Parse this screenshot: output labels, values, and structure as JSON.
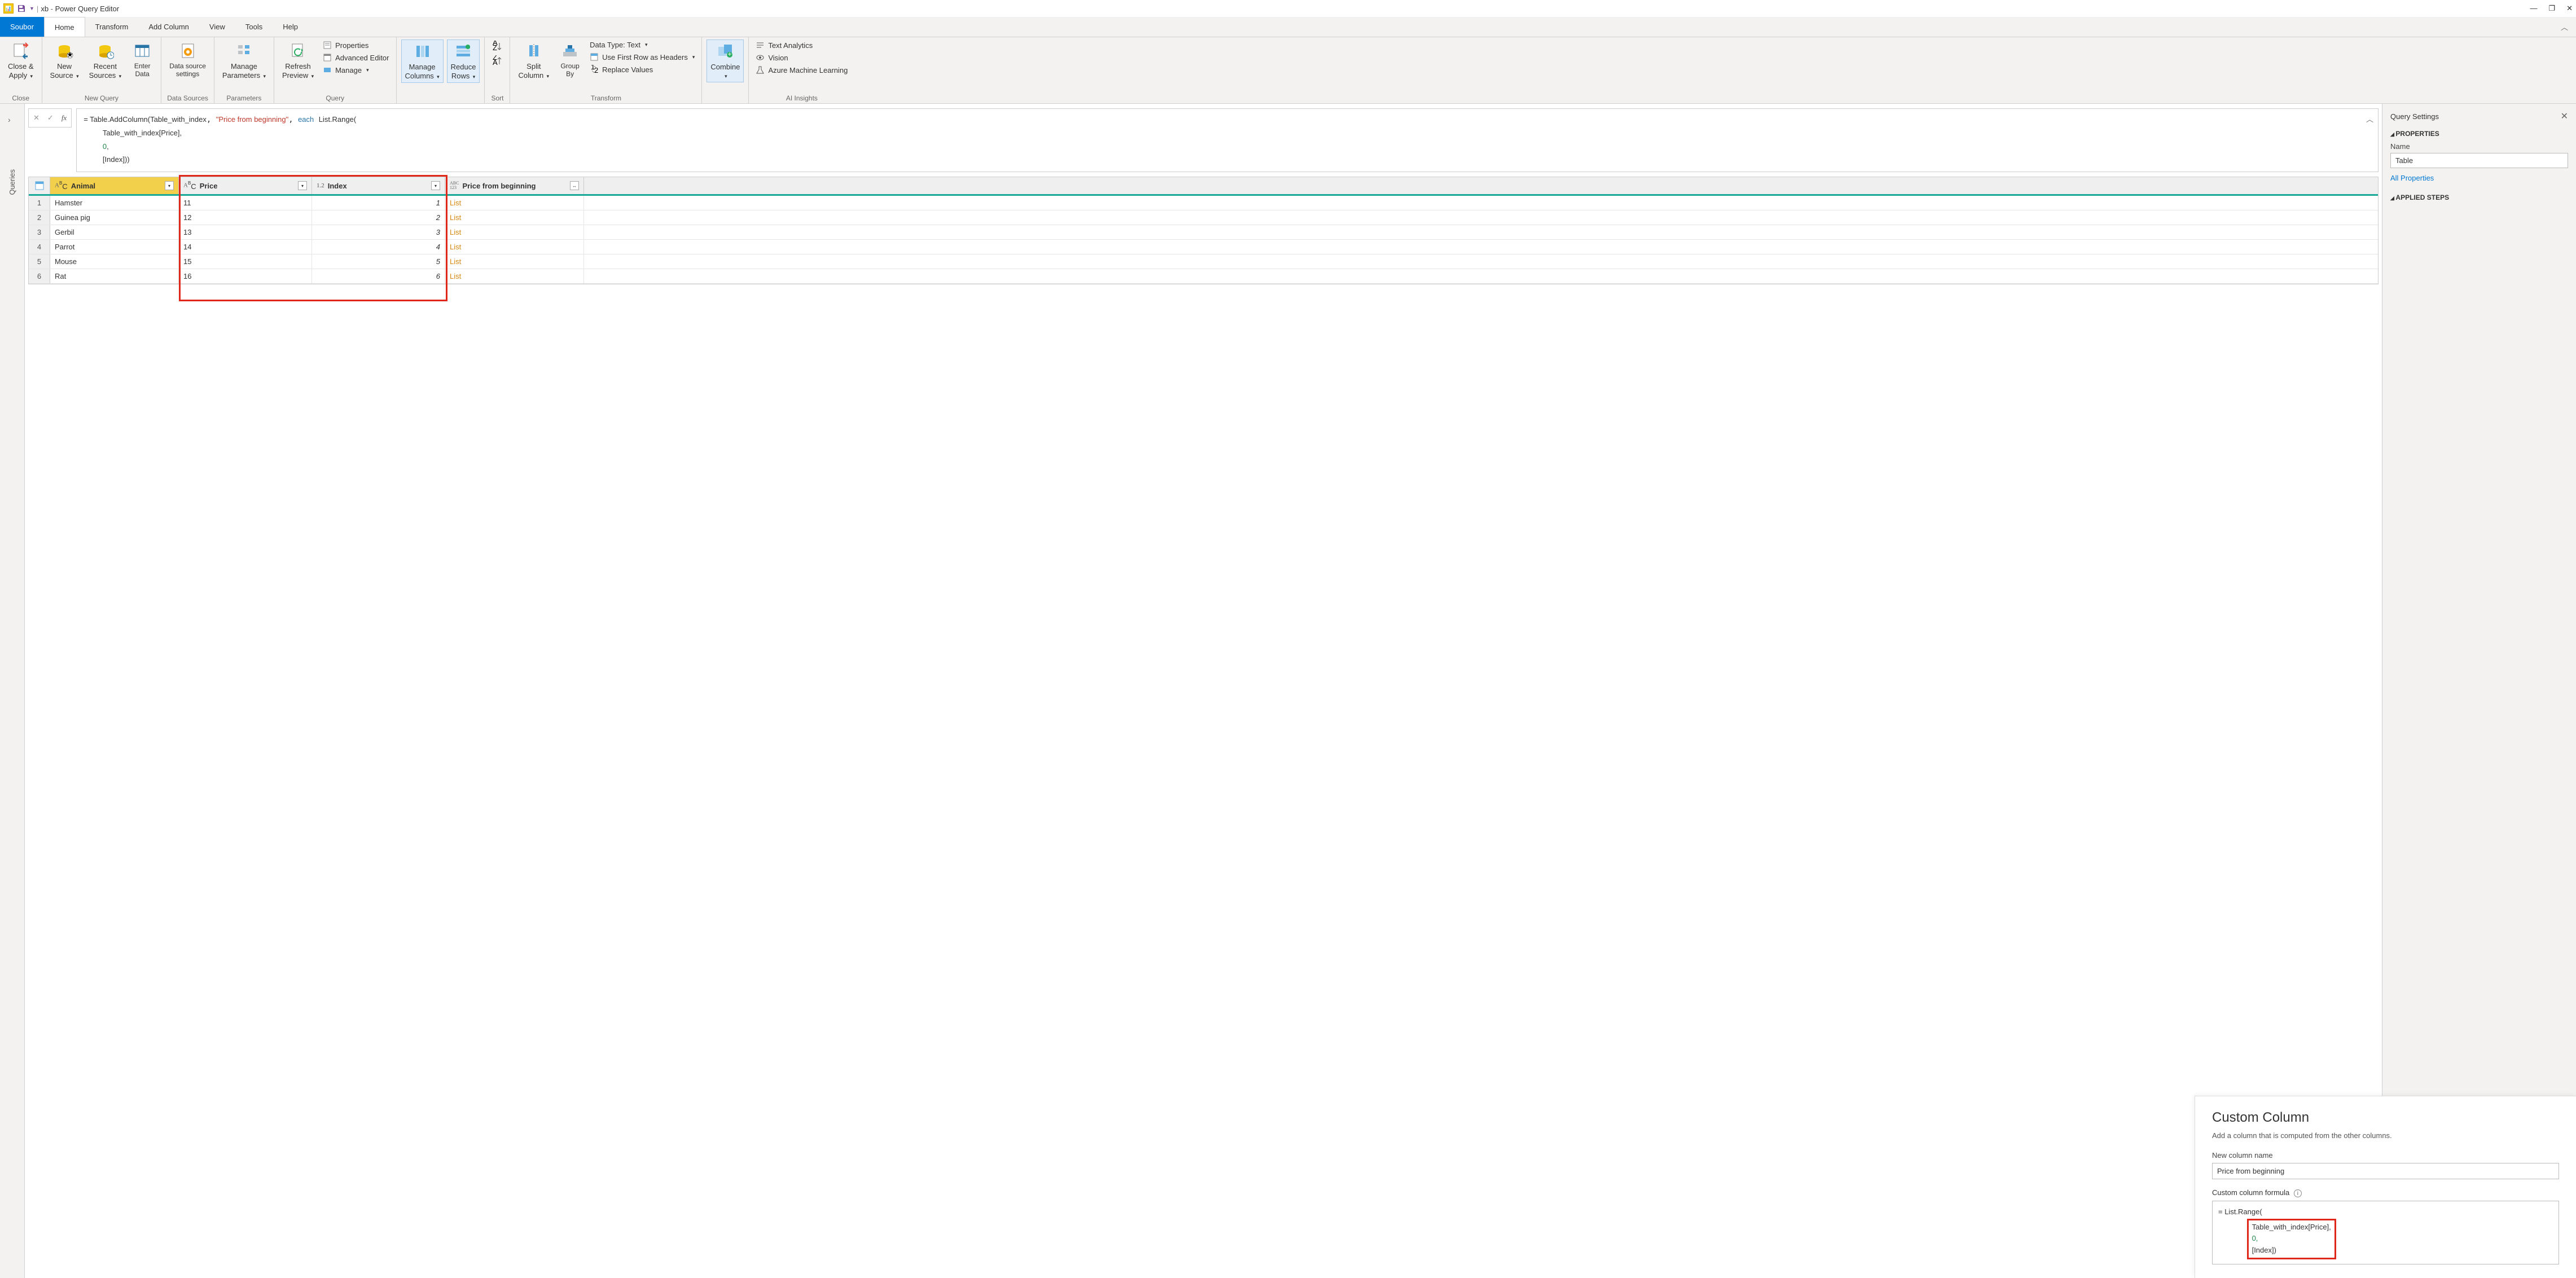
{
  "titlebar": {
    "app": "xb",
    "suffix": "Power Query Editor"
  },
  "menu": {
    "file": "Soubor",
    "tabs": [
      "Home",
      "Transform",
      "Add Column",
      "View",
      "Tools",
      "Help"
    ]
  },
  "ribbon": {
    "close": {
      "btn": "Close &\nApply",
      "label": "Close"
    },
    "newquery": {
      "b1": "New\nSource",
      "b2": "Recent\nSources",
      "b3": "Enter\nData",
      "label": "New Query"
    },
    "datasources": {
      "b": "Data source\nsettings",
      "label": "Data Sources"
    },
    "params": {
      "b": "Manage\nParameters",
      "label": "Parameters"
    },
    "query": {
      "b": "Refresh\nPreview",
      "i1": "Properties",
      "i2": "Advanced Editor",
      "i3": "Manage",
      "label": "Query"
    },
    "cols": {
      "b1": "Manage\nColumns",
      "b2": "Reduce\nRows"
    },
    "sort": {
      "label": "Sort"
    },
    "transform": {
      "b1": "Split\nColumn",
      "b2": "Group\nBy",
      "i1": "Data Type: Text",
      "i2": "Use First Row as Headers",
      "i3": "Replace Values",
      "label": "Transform"
    },
    "combine": {
      "b": "Combine"
    },
    "ai": {
      "i1": "Text Analytics",
      "i2": "Vision",
      "i3": "Azure Machine Learning",
      "label": "AI Insights"
    }
  },
  "queries_label": "Queries",
  "formula": {
    "prefix": "= ",
    "fn": "Table.AddColumn",
    "open": "(",
    "a1": "Table_with_index",
    "str": "\"Price from beginning\"",
    "kw": "each",
    "fn2": "List.Range",
    "open2": "(",
    "l2": "Table_with_index[Price],",
    "l3": "0",
    "l3s": ",",
    "l4": "[Index]))"
  },
  "table": {
    "cols": {
      "animal": "Animal",
      "price": "Price",
      "index": "Index",
      "pfb": "Price from beginning"
    },
    "typ": {
      "abc": "AᴮC",
      "num": "1.2",
      "any": "ABC\n123"
    },
    "rows": [
      {
        "n": "1",
        "a": "Hamster",
        "p": "11",
        "i": "1",
        "l": "List"
      },
      {
        "n": "2",
        "a": "Guinea pig",
        "p": "12",
        "i": "2",
        "l": "List"
      },
      {
        "n": "3",
        "a": "Gerbil",
        "p": "13",
        "i": "3",
        "l": "List"
      },
      {
        "n": "4",
        "a": "Parrot",
        "p": "14",
        "i": "4",
        "l": "List"
      },
      {
        "n": "5",
        "a": "Mouse",
        "p": "15",
        "i": "5",
        "l": "List"
      },
      {
        "n": "6",
        "a": "Rat",
        "p": "16",
        "i": "6",
        "l": "List"
      }
    ]
  },
  "settings": {
    "title": "Query Settings",
    "prop": "PROPERTIES",
    "name_lbl": "Name",
    "name_val": "Table",
    "allprops": "All Properties",
    "steps": "APPLIED STEPS"
  },
  "dialog": {
    "title": "Custom Column",
    "sub": "Add a column that is computed from the other columns.",
    "name_lbl": "New column name",
    "name_val": "Price from beginning",
    "formula_lbl": "Custom column formula",
    "line1": "= List.Range(",
    "line2": "Table_with_index[Price],",
    "line3": "0,",
    "line4": "[Index])"
  }
}
